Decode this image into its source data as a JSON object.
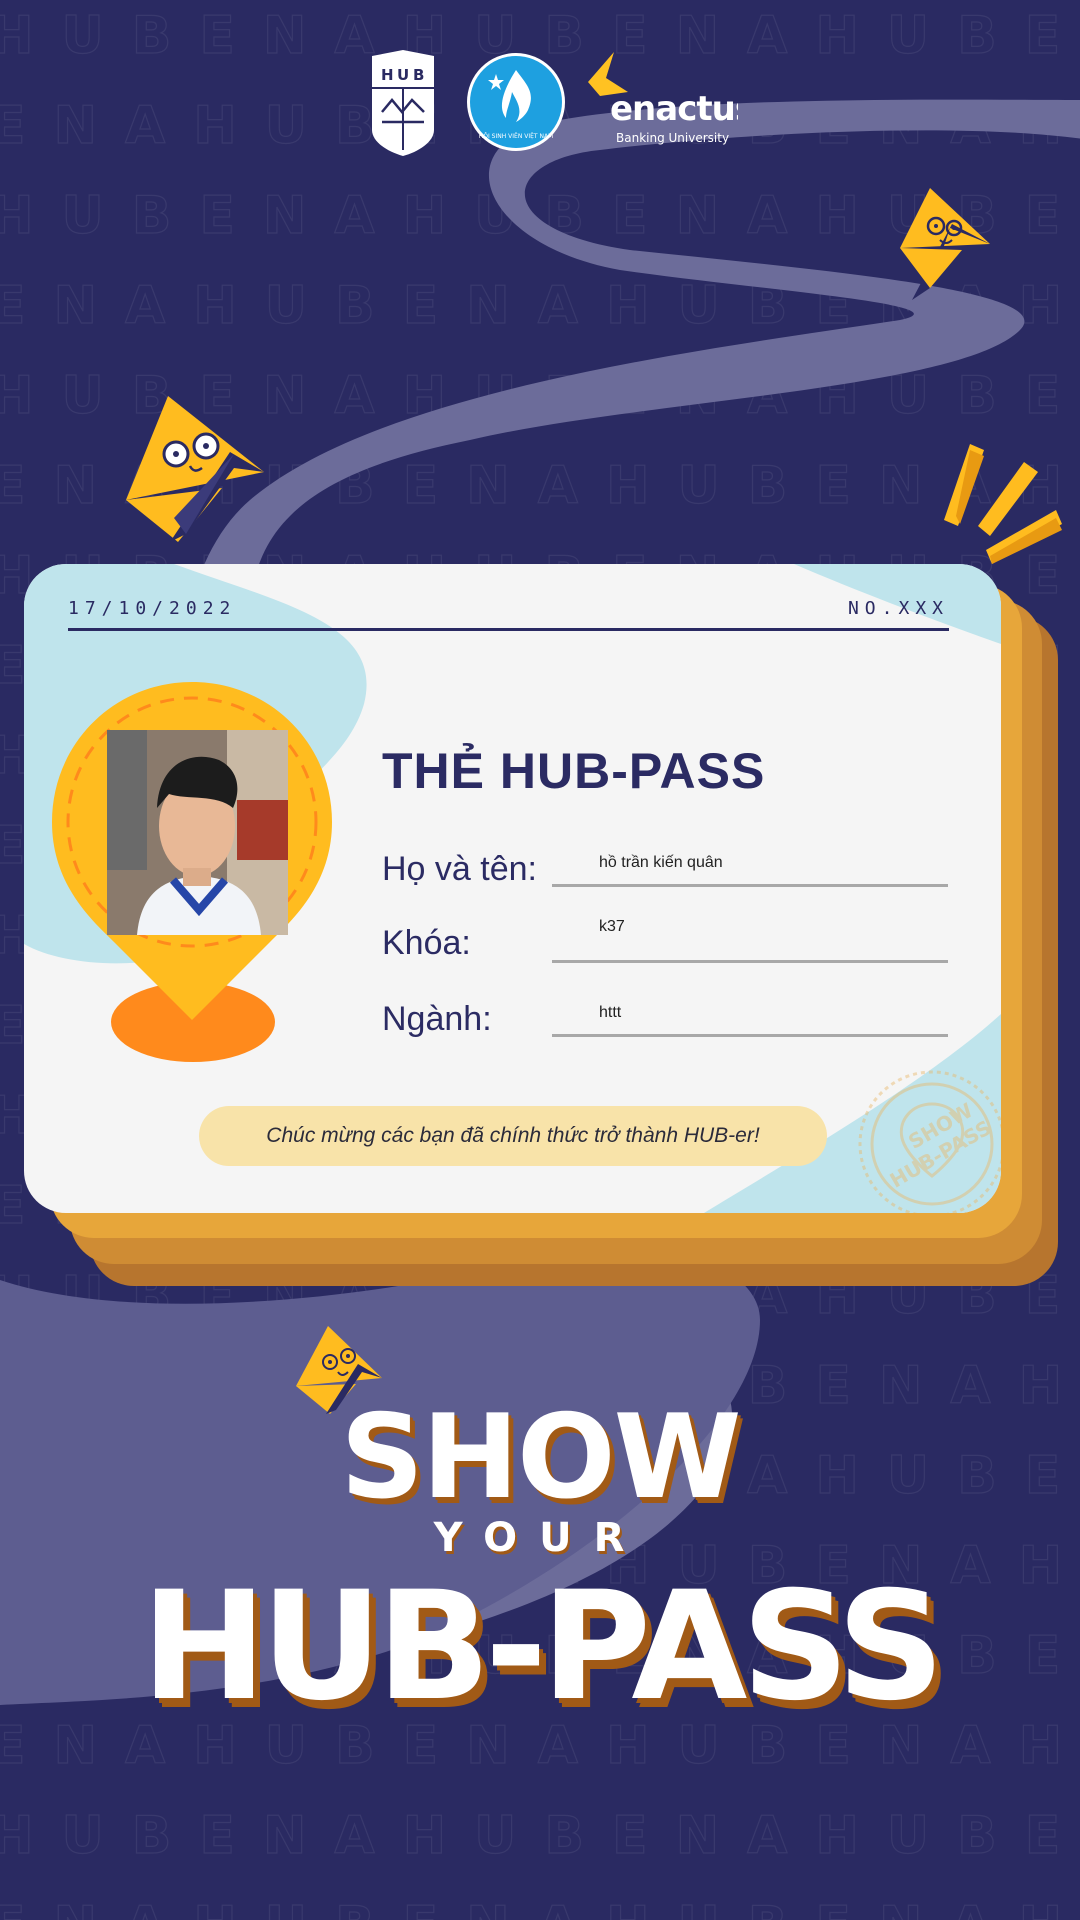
{
  "colors": {
    "background": "#2a2a62",
    "road": "#6a6a98",
    "card": "#f5f5f5",
    "card_accent": "#bfe4ec",
    "gold": "#ffbc1f",
    "orange": "#ff8a1c",
    "navy": "#2b2b63",
    "shadow": "#a15a16"
  },
  "pattern": {
    "word": "HUBENA"
  },
  "logos": {
    "hub": {
      "letters": [
        "H",
        "U",
        "B"
      ]
    },
    "hsv": {
      "text": "HỘI SINH VIÊN VIỆT NAM"
    },
    "enactus": {
      "name": "enactus",
      "subtitle": "Banking University"
    }
  },
  "card": {
    "date": "17/10/2022",
    "number": "NO.XXX",
    "title": "THẺ HUB-PASS",
    "fields": [
      {
        "label": "Họ và tên:",
        "value": "hồ trần kiến quân"
      },
      {
        "label": "Khóa:",
        "value": "k37"
      },
      {
        "label": "Ngành:",
        "value": "httt"
      }
    ],
    "message": "Chúc mừng các bạn đã chính thức trở thành HUB-er!",
    "stamp": {
      "line1": "SHOW",
      "line2": "HUB-PASS"
    }
  },
  "headline": {
    "line1": "SHOW",
    "line2": "YOUR",
    "line3": "HUB-PASS"
  },
  "icons": [
    "mascot-icon",
    "sparkle-lines-icon",
    "map-pin-icon",
    "stamp-icon"
  ]
}
